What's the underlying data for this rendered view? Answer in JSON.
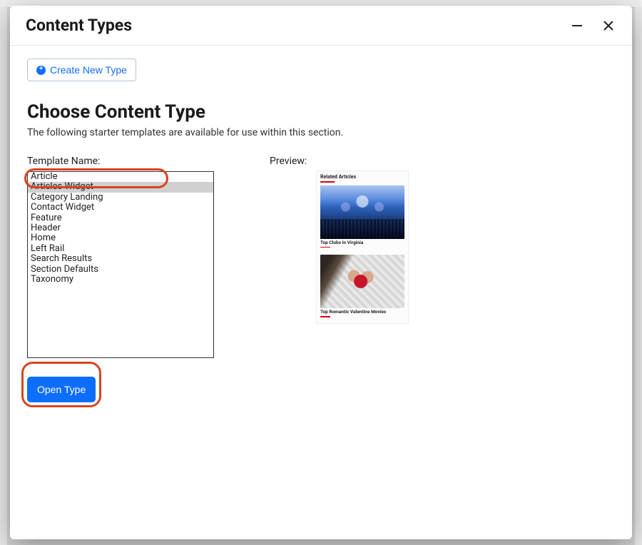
{
  "header": {
    "title": "Content Types"
  },
  "create_button": {
    "label": "Create New Type"
  },
  "section": {
    "title": "Choose Content Type",
    "description": "The following starter templates are available for use within this section."
  },
  "template_list": {
    "label": "Template Name:",
    "items": [
      "Article",
      "Articles Widget",
      "Category Landing",
      "Contact Widget",
      "Feature",
      "Header",
      "Home",
      "Left Rail",
      "Search Results",
      "Section Defaults",
      "Taxonomy"
    ],
    "selected_index": 1
  },
  "preview": {
    "label": "Preview:",
    "heading": "Related Articles",
    "card1_caption": "Top Clubs In Virginia",
    "card2_caption": "Top Romantic Valentine Movies"
  },
  "open_button": {
    "label": "Open Type"
  }
}
